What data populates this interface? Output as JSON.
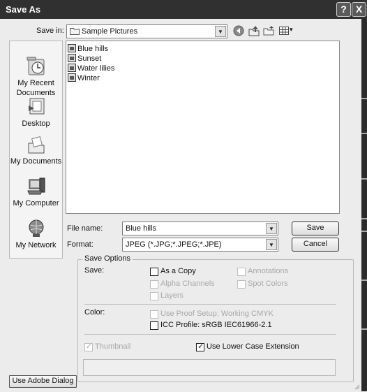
{
  "window": {
    "title": "Save As"
  },
  "title_buttons": {
    "help": "?",
    "close": "X"
  },
  "save_in": {
    "label": "Save in:",
    "value": "Sample Pictures"
  },
  "toolbar": {
    "view_menu_arrow": "▾"
  },
  "places": [
    {
      "label_line1": "My Recent",
      "label_line2": "Documents",
      "icon": "recent-documents-icon"
    },
    {
      "label_line1": "Desktop",
      "label_line2": "",
      "icon": "desktop-icon"
    },
    {
      "label_line1": "My Documents",
      "label_line2": "",
      "icon": "my-documents-icon"
    },
    {
      "label_line1": "My Computer",
      "label_line2": "",
      "icon": "my-computer-icon"
    },
    {
      "label_line1": "My Network",
      "label_line2": "",
      "icon": "my-network-icon"
    }
  ],
  "files": [
    "Blue hills",
    "Sunset",
    "Water lilies",
    "Winter"
  ],
  "file_name": {
    "label": "File name:",
    "value": "Blue hills"
  },
  "format": {
    "label": "Format:",
    "value": "JPEG (*.JPG;*.JPEG;*.JPE)"
  },
  "buttons": {
    "save": "Save",
    "cancel": "Cancel",
    "use_adobe_dialog": "Use Adobe Dialog"
  },
  "save_options": {
    "title": "Save Options",
    "save_label": "Save:",
    "as_a_copy": "As a Copy",
    "annotations": "Annotations",
    "alpha_channels": "Alpha Channels",
    "spot_colors": "Spot Colors",
    "layers": "Layers",
    "color_label": "Color:",
    "use_proof_setup": "Use Proof Setup:  Working CMYK",
    "icc_profile": "ICC Profile:  sRGB IEC61966-2.1",
    "thumbnail": "Thumbnail",
    "lower_case_extension": "Use Lower Case Extension"
  }
}
